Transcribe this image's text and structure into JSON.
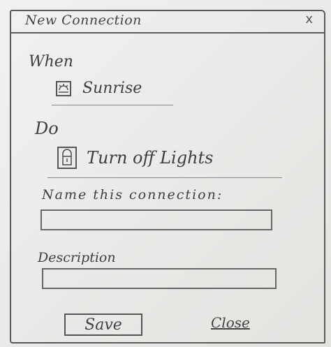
{
  "dialog": {
    "title": "New Connection",
    "close_glyph": "x"
  },
  "trigger": {
    "heading": "When",
    "icon": "sunrise-icon",
    "label": "Sunrise"
  },
  "action": {
    "heading": "Do",
    "icon": "lock-icon",
    "label": "Turn off Lights"
  },
  "name_field": {
    "label": "Name this connection:",
    "value": ""
  },
  "description_field": {
    "label": "Description",
    "value": ""
  },
  "buttons": {
    "save_label": "Save",
    "close_label": "Close"
  }
}
